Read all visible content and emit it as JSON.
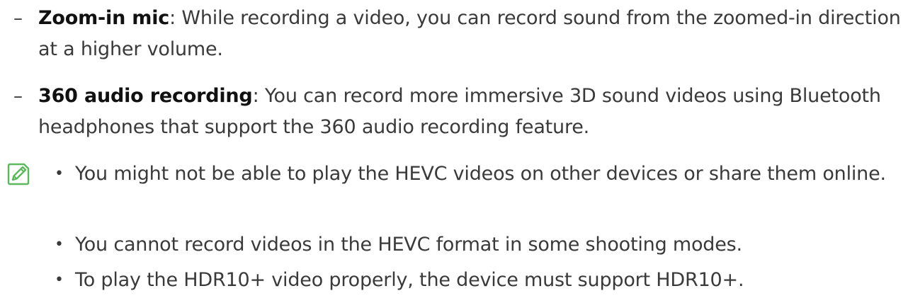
{
  "options": [
    {
      "dash": "–",
      "term": "Zoom-in mic",
      "description": ": While recording a video, you can record sound from the zoomed-in direction at a higher volume."
    },
    {
      "dash": "–",
      "term": "360 audio recording",
      "description": ": You can record more immersive 3D sound videos using Bluetooth headphones that support the 360 audio recording feature."
    }
  ],
  "note": {
    "icon": "note-pencil-icon",
    "icon_color": "#5cb85c",
    "bullet": "•",
    "items": [
      "You might not be able to play the HEVC videos on other devices or share them online.",
      "You cannot record videos in the HEVC format in some shooting modes.",
      "To play the HDR10+ video properly, the device must support HDR10+."
    ]
  }
}
